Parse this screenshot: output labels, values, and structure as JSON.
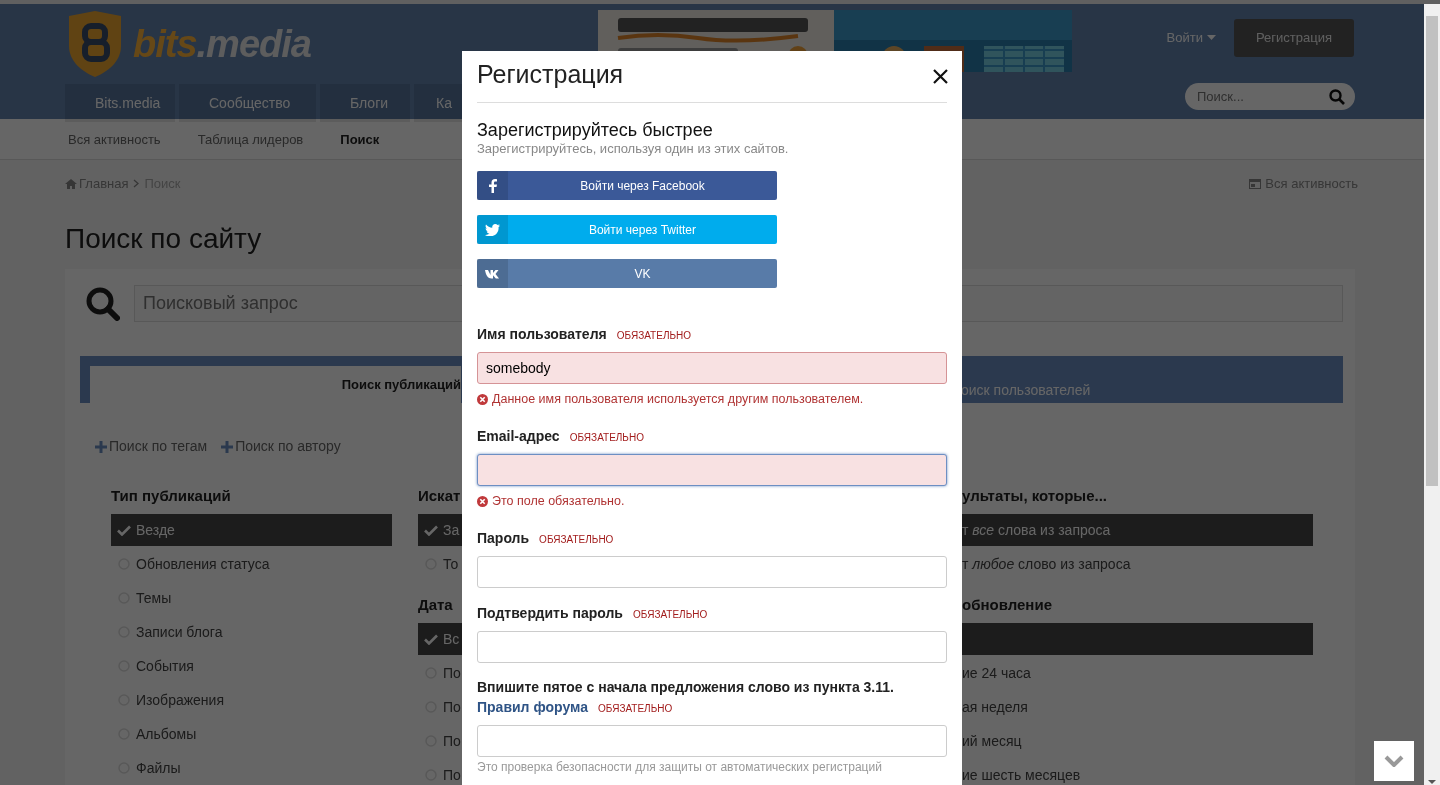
{
  "header": {
    "logo_parts": [
      "bits",
      ".media"
    ],
    "ads": [
      {
        "kind": "picture"
      },
      {
        "kind": "picture"
      }
    ],
    "login": "Войти",
    "register": "Регистрация",
    "nav": [
      {
        "label": "Bits.media"
      },
      {
        "label": "Сообщество"
      },
      {
        "label": "Блоги"
      },
      {
        "label": "Ка"
      }
    ],
    "search": {
      "placeholder": "Поиск..."
    }
  },
  "subnav": [
    {
      "label": "Вся активность",
      "selected": false
    },
    {
      "label": "Таблица лидеров",
      "selected": false
    },
    {
      "label": "Поиск",
      "selected": true
    }
  ],
  "breadcrumb": {
    "items": [
      "Главная",
      "Поиск"
    ],
    "right_link": "Вся активность"
  },
  "page_title": "Поиск по сайту",
  "search": {
    "placeholder": "Поисковый запрос"
  },
  "tabs": [
    {
      "label": "Поиск публикаций",
      "selected": true
    },
    {
      "label": "оиск пользователей",
      "selected": false
    }
  ],
  "add_links": [
    "Поиск по тегам",
    "Поиск по автору"
  ],
  "filter_columns": [
    {
      "groups": [
        {
          "title": "Тип публикаций",
          "options": [
            {
              "label": "Везде",
              "selected": true
            },
            {
              "label": "Обновления статуса",
              "selected": false
            },
            {
              "label": "Темы",
              "selected": false
            },
            {
              "label": "Записи блога",
              "selected": false
            },
            {
              "label": "События",
              "selected": false
            },
            {
              "label": "Изображения",
              "selected": false
            },
            {
              "label": "Альбомы",
              "selected": false
            },
            {
              "label": "Файлы",
              "selected": false
            }
          ]
        }
      ]
    },
    {
      "groups": [
        {
          "title": "Искат",
          "options": [
            {
              "label": "За",
              "selected": true
            },
            {
              "label": "То",
              "selected": false
            }
          ]
        },
        {
          "title": "Дата",
          "options": [
            {
              "label": "Вс",
              "selected": true
            },
            {
              "label": "По",
              "selected": false
            },
            {
              "label": "По",
              "selected": false
            },
            {
              "label": "По",
              "selected": false
            },
            {
              "label": "По",
              "selected": false
            }
          ]
        }
      ]
    },
    {
      "groups": [
        {
          "title": "ультаты, которые...",
          "options": [
            {
              "label": "т *все* слова из запроса",
              "selected": true
            },
            {
              "label": "т *любое* слово из запроса",
              "selected": false
            }
          ]
        },
        {
          "title": "обновление",
          "options": [
            {
              "selected": true
            },
            {
              "label": "ие 24 часа",
              "selected": false
            },
            {
              "label": "ая неделя",
              "selected": false
            },
            {
              "label": "ий месяц",
              "selected": false
            },
            {
              "label": "ие шесть месяцев",
              "selected": false
            }
          ]
        }
      ]
    }
  ],
  "modal": {
    "title": "Регистрация",
    "quick_title": "Зарегистрируйтесь быстрее",
    "quick_subtitle": "Зарегистрируйтесь, используя один из этих сайтов.",
    "social": [
      {
        "kind": "facebook",
        "label": "Войти через Facebook",
        "color": "#3b5998"
      },
      {
        "kind": "twitter",
        "label": "Войти через Twitter",
        "color": "#00aced"
      },
      {
        "kind": "vk",
        "label": "VK",
        "color": "#587ba8"
      }
    ],
    "fields": [
      {
        "label": "Имя пользователя",
        "required": "ОБЯЗАТЕЛЬНО",
        "value": "somebody",
        "invalid": true,
        "focused": false,
        "error": "Данное имя пользователя используется другим пользователем."
      },
      {
        "label": "Email-адрес",
        "required": "ОБЯЗАТЕЛЬНО",
        "invalid": true,
        "focused": true,
        "error": "Это поле обязательно."
      },
      {
        "label": "Пароль",
        "required": "ОБЯЗАТЕЛЬНО",
        "invalid": false,
        "focused": false
      },
      {
        "label": "Подтвердить пароль",
        "required": "ОБЯЗАТЕЛЬНО",
        "invalid": false,
        "focused": false
      },
      {
        "label": "Впишите пятое с начала предложения слово из пункта 3.11.",
        "label_link": "Правил форума",
        "required": "ОБЯЗАТЕЛЬНО",
        "invalid": false,
        "focused": false,
        "hint": "Это проверка безопасности для защиты от автоматических регистраций"
      }
    ]
  }
}
